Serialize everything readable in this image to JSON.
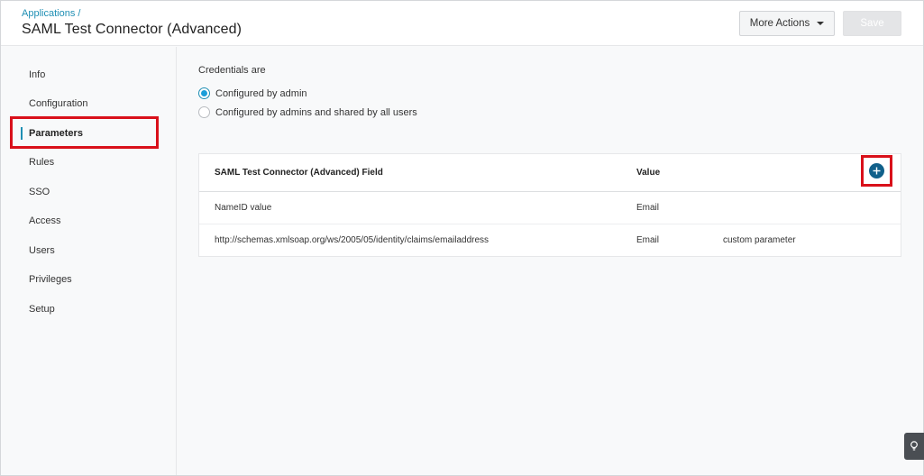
{
  "header": {
    "breadcrumb": "Applications /",
    "title": "SAML Test Connector (Advanced)",
    "more_actions_label": "More Actions",
    "save_label": "Save"
  },
  "sidebar": {
    "items": [
      {
        "label": "Info"
      },
      {
        "label": "Configuration"
      },
      {
        "label": "Parameters",
        "active": true
      },
      {
        "label": "Rules"
      },
      {
        "label": "SSO"
      },
      {
        "label": "Access"
      },
      {
        "label": "Users"
      },
      {
        "label": "Privileges"
      },
      {
        "label": "Setup"
      }
    ]
  },
  "credentials": {
    "label": "Credentials are",
    "options": [
      {
        "label": "Configured by admin",
        "checked": true
      },
      {
        "label": "Configured by admins and shared by all users",
        "checked": false
      }
    ]
  },
  "table": {
    "headers": {
      "field": "SAML Test Connector (Advanced) Field",
      "value": "Value"
    },
    "rows": [
      {
        "field": "NameID value",
        "value": "Email",
        "note": ""
      },
      {
        "field": "http://schemas.xmlsoap.org/ws/2005/05/identity/claims/emailaddress",
        "value": "Email",
        "note": "custom parameter"
      }
    ]
  },
  "colors": {
    "accent": "#1f8fb4",
    "add_button": "#11608a",
    "highlight": "#d9101a"
  },
  "icons": {
    "add": "plus-icon",
    "dropdown": "caret-down-icon",
    "help": "lightbulb-icon"
  }
}
